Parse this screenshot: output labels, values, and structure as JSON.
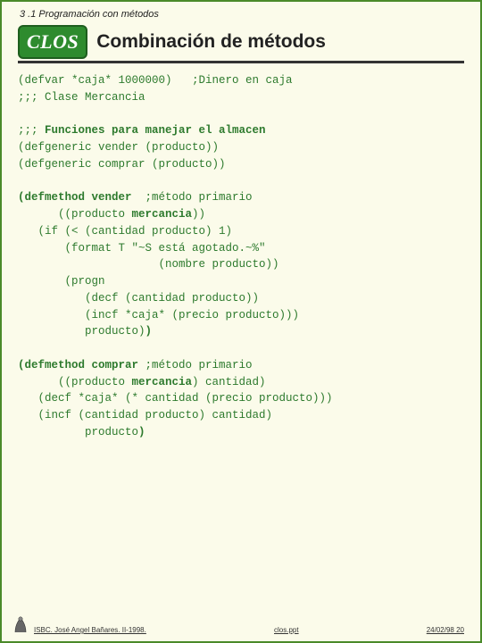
{
  "section_label": "3 .1 Programación con métodos",
  "badge": "CLOS",
  "title": "Combinación de métodos",
  "code_lines": [
    {
      "t": "(defvar *caja* 1000000)   ;Dinero en caja"
    },
    {
      "t": ";;; Clase Mercancia"
    },
    {
      "t": ""
    },
    {
      "t": ";;; ",
      "b": "Funciones para manejar el almacen"
    },
    {
      "t": "(defgeneric vender (producto))"
    },
    {
      "t": "(defgeneric comprar (producto))"
    },
    {
      "t": ""
    },
    {
      "b": "(defmethod vender",
      "t2": "  ;método primario"
    },
    {
      "t": "      ((producto ",
      "b": "mercancia",
      "t2": "))"
    },
    {
      "t": "   (if (< (cantidad producto) 1)"
    },
    {
      "t": "       (format T \"~S está agotado.~%\""
    },
    {
      "t": "                     (nombre producto))"
    },
    {
      "t": "       (progn"
    },
    {
      "t": "          (decf (cantidad producto))"
    },
    {
      "t": "          (incf *caja* (precio producto)))"
    },
    {
      "t": "          producto)",
      "b": ")"
    },
    {
      "t": ""
    },
    {
      "b": "(defmethod comprar",
      "t2": " ;método primario"
    },
    {
      "t": "      ((producto ",
      "b": "mercancia",
      "t2": ") cantidad)"
    },
    {
      "t": "   (decf *caja* (* cantidad (precio producto)))"
    },
    {
      "t": "   (incf (cantidad producto) cantidad)"
    },
    {
      "t": "          producto",
      "b": ")"
    }
  ],
  "footer": {
    "left": "ISBC. José Angel Bañares. II-1998.",
    "center": "clos.ppt",
    "right": "24/02/98  20"
  }
}
